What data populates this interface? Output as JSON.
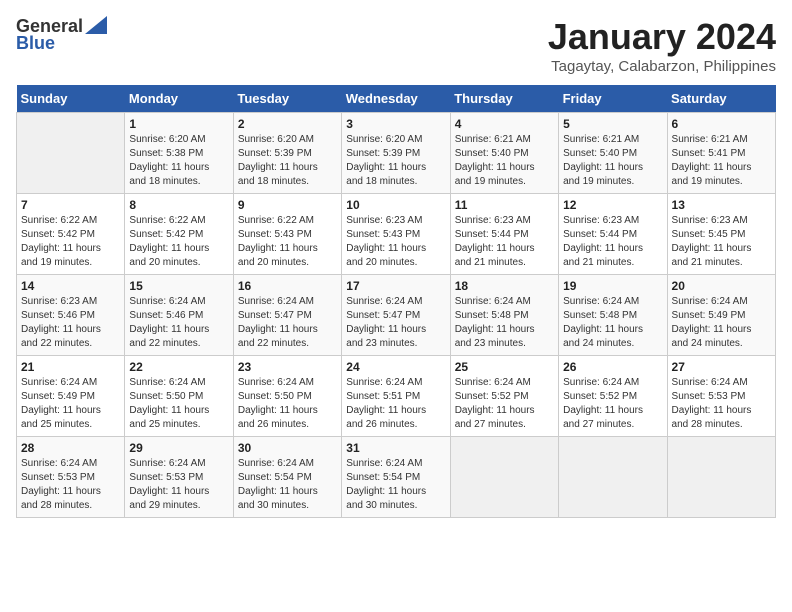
{
  "logo": {
    "general": "General",
    "blue": "Blue"
  },
  "title": "January 2024",
  "subtitle": "Tagaytay, Calabarzon, Philippines",
  "days_header": [
    "Sunday",
    "Monday",
    "Tuesday",
    "Wednesday",
    "Thursday",
    "Friday",
    "Saturday"
  ],
  "weeks": [
    [
      {
        "num": "",
        "info": ""
      },
      {
        "num": "1",
        "info": "Sunrise: 6:20 AM\nSunset: 5:38 PM\nDaylight: 11 hours\nand 18 minutes."
      },
      {
        "num": "2",
        "info": "Sunrise: 6:20 AM\nSunset: 5:39 PM\nDaylight: 11 hours\nand 18 minutes."
      },
      {
        "num": "3",
        "info": "Sunrise: 6:20 AM\nSunset: 5:39 PM\nDaylight: 11 hours\nand 18 minutes."
      },
      {
        "num": "4",
        "info": "Sunrise: 6:21 AM\nSunset: 5:40 PM\nDaylight: 11 hours\nand 19 minutes."
      },
      {
        "num": "5",
        "info": "Sunrise: 6:21 AM\nSunset: 5:40 PM\nDaylight: 11 hours\nand 19 minutes."
      },
      {
        "num": "6",
        "info": "Sunrise: 6:21 AM\nSunset: 5:41 PM\nDaylight: 11 hours\nand 19 minutes."
      }
    ],
    [
      {
        "num": "7",
        "info": "Sunrise: 6:22 AM\nSunset: 5:42 PM\nDaylight: 11 hours\nand 19 minutes."
      },
      {
        "num": "8",
        "info": "Sunrise: 6:22 AM\nSunset: 5:42 PM\nDaylight: 11 hours\nand 20 minutes."
      },
      {
        "num": "9",
        "info": "Sunrise: 6:22 AM\nSunset: 5:43 PM\nDaylight: 11 hours\nand 20 minutes."
      },
      {
        "num": "10",
        "info": "Sunrise: 6:23 AM\nSunset: 5:43 PM\nDaylight: 11 hours\nand 20 minutes."
      },
      {
        "num": "11",
        "info": "Sunrise: 6:23 AM\nSunset: 5:44 PM\nDaylight: 11 hours\nand 21 minutes."
      },
      {
        "num": "12",
        "info": "Sunrise: 6:23 AM\nSunset: 5:44 PM\nDaylight: 11 hours\nand 21 minutes."
      },
      {
        "num": "13",
        "info": "Sunrise: 6:23 AM\nSunset: 5:45 PM\nDaylight: 11 hours\nand 21 minutes."
      }
    ],
    [
      {
        "num": "14",
        "info": "Sunrise: 6:23 AM\nSunset: 5:46 PM\nDaylight: 11 hours\nand 22 minutes."
      },
      {
        "num": "15",
        "info": "Sunrise: 6:24 AM\nSunset: 5:46 PM\nDaylight: 11 hours\nand 22 minutes."
      },
      {
        "num": "16",
        "info": "Sunrise: 6:24 AM\nSunset: 5:47 PM\nDaylight: 11 hours\nand 22 minutes."
      },
      {
        "num": "17",
        "info": "Sunrise: 6:24 AM\nSunset: 5:47 PM\nDaylight: 11 hours\nand 23 minutes."
      },
      {
        "num": "18",
        "info": "Sunrise: 6:24 AM\nSunset: 5:48 PM\nDaylight: 11 hours\nand 23 minutes."
      },
      {
        "num": "19",
        "info": "Sunrise: 6:24 AM\nSunset: 5:48 PM\nDaylight: 11 hours\nand 24 minutes."
      },
      {
        "num": "20",
        "info": "Sunrise: 6:24 AM\nSunset: 5:49 PM\nDaylight: 11 hours\nand 24 minutes."
      }
    ],
    [
      {
        "num": "21",
        "info": "Sunrise: 6:24 AM\nSunset: 5:49 PM\nDaylight: 11 hours\nand 25 minutes."
      },
      {
        "num": "22",
        "info": "Sunrise: 6:24 AM\nSunset: 5:50 PM\nDaylight: 11 hours\nand 25 minutes."
      },
      {
        "num": "23",
        "info": "Sunrise: 6:24 AM\nSunset: 5:50 PM\nDaylight: 11 hours\nand 26 minutes."
      },
      {
        "num": "24",
        "info": "Sunrise: 6:24 AM\nSunset: 5:51 PM\nDaylight: 11 hours\nand 26 minutes."
      },
      {
        "num": "25",
        "info": "Sunrise: 6:24 AM\nSunset: 5:52 PM\nDaylight: 11 hours\nand 27 minutes."
      },
      {
        "num": "26",
        "info": "Sunrise: 6:24 AM\nSunset: 5:52 PM\nDaylight: 11 hours\nand 27 minutes."
      },
      {
        "num": "27",
        "info": "Sunrise: 6:24 AM\nSunset: 5:53 PM\nDaylight: 11 hours\nand 28 minutes."
      }
    ],
    [
      {
        "num": "28",
        "info": "Sunrise: 6:24 AM\nSunset: 5:53 PM\nDaylight: 11 hours\nand 28 minutes."
      },
      {
        "num": "29",
        "info": "Sunrise: 6:24 AM\nSunset: 5:53 PM\nDaylight: 11 hours\nand 29 minutes."
      },
      {
        "num": "30",
        "info": "Sunrise: 6:24 AM\nSunset: 5:54 PM\nDaylight: 11 hours\nand 30 minutes."
      },
      {
        "num": "31",
        "info": "Sunrise: 6:24 AM\nSunset: 5:54 PM\nDaylight: 11 hours\nand 30 minutes."
      },
      {
        "num": "",
        "info": ""
      },
      {
        "num": "",
        "info": ""
      },
      {
        "num": "",
        "info": ""
      }
    ]
  ]
}
